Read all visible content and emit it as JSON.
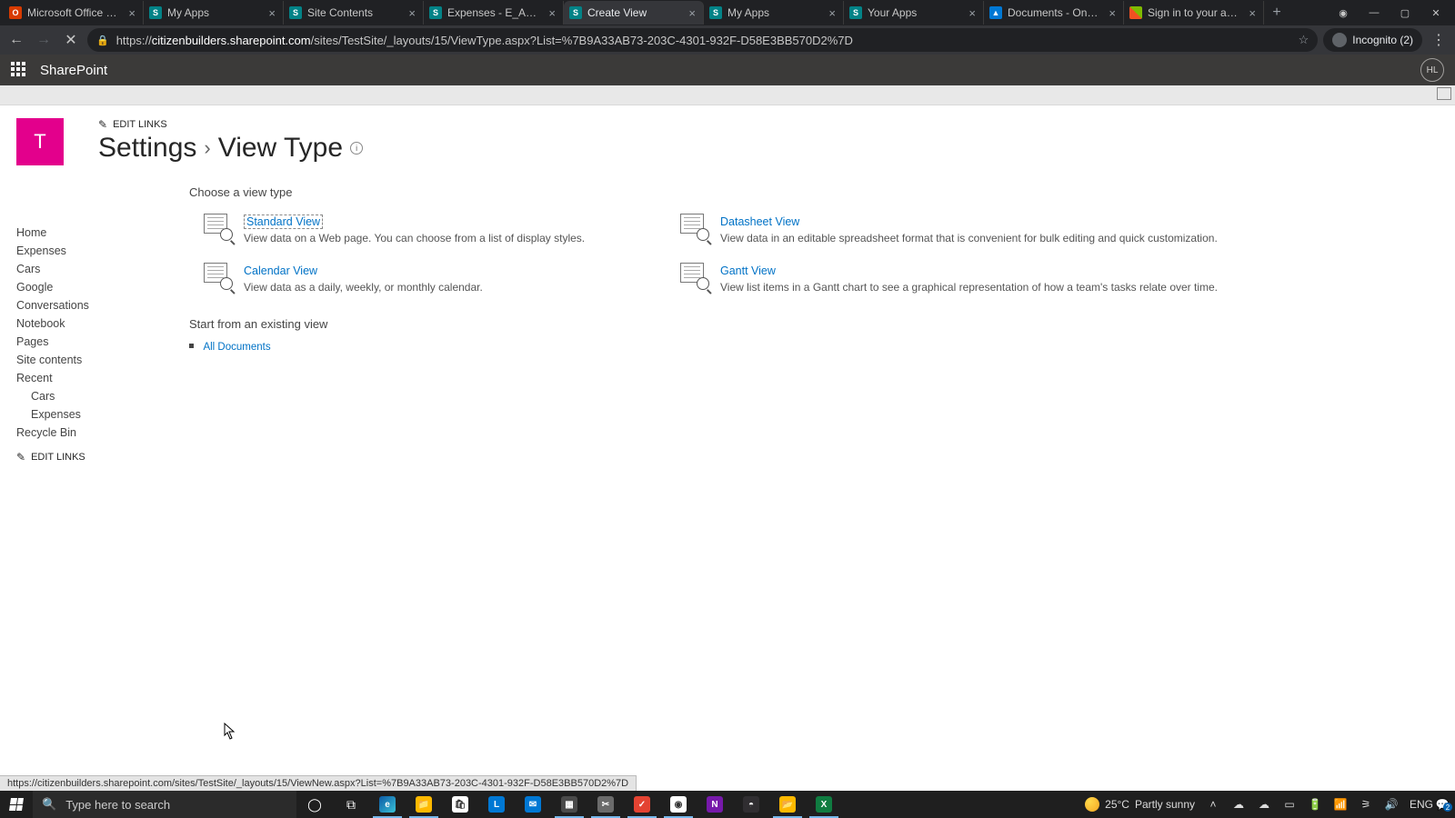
{
  "browser": {
    "tabs": [
      {
        "title": "Microsoft Office Home",
        "fav": "office"
      },
      {
        "title": "My Apps",
        "fav": "sp"
      },
      {
        "title": "Site Contents",
        "fav": "sp"
      },
      {
        "title": "Expenses - E_Account",
        "fav": "sp"
      },
      {
        "title": "Create View",
        "fav": "sp",
        "active": true
      },
      {
        "title": "My Apps",
        "fav": "sp"
      },
      {
        "title": "Your Apps",
        "fav": "sp"
      },
      {
        "title": "Documents - OneDriv",
        "fav": "onedrive"
      },
      {
        "title": "Sign in to your accoun",
        "fav": "ms"
      }
    ],
    "url_prefix": "https://",
    "url_host": "citizenbuilders.sharepoint.com",
    "url_path": "/sites/TestSite/_layouts/15/ViewType.aspx?List=%7B9A33AB73-203C-4301-932F-D58E3BB570D2%7D",
    "incognito_label": "Incognito (2)"
  },
  "suite": {
    "product": "SharePoint",
    "avatar": "HL"
  },
  "header": {
    "site_initial": "T",
    "edit_links": "EDIT LINKS",
    "crumb_settings": "Settings",
    "crumb_sep": "›",
    "crumb_page": "View Type"
  },
  "quicklaunch": {
    "items": [
      "Home",
      "Expenses",
      "Cars",
      "Google",
      "Conversations",
      "Notebook",
      "Pages",
      "Site contents",
      "Recent"
    ],
    "recent_children": [
      "Cars",
      "Expenses"
    ],
    "recycle": "Recycle Bin",
    "edit_links": "EDIT LINKS"
  },
  "content": {
    "choose_title": "Choose a view type",
    "views": {
      "standard": {
        "name": "Standard View",
        "desc": "View data on a Web page. You can choose from a list of display styles."
      },
      "datasheet": {
        "name": "Datasheet View",
        "desc": "View data in an editable spreadsheet format that is convenient for bulk editing and quick customization."
      },
      "calendar": {
        "name": "Calendar View",
        "desc": "View data as a daily, weekly, or monthly calendar."
      },
      "gantt": {
        "name": "Gantt View",
        "desc": "View list items in a Gantt chart to see a graphical representation of how a team's tasks relate over time."
      }
    },
    "existing_title": "Start from an existing view",
    "existing_link": "All Documents"
  },
  "status_hover": "https://citizenbuilders.sharepoint.com/sites/TestSite/_layouts/15/ViewNew.aspx?List=%7B9A33AB73-203C-4301-932F-D58E3BB570D2%7D",
  "taskbar": {
    "search_placeholder": "Type here to search",
    "weather_temp": "25°C",
    "weather_text": "Partly sunny",
    "lang": "ENG"
  }
}
